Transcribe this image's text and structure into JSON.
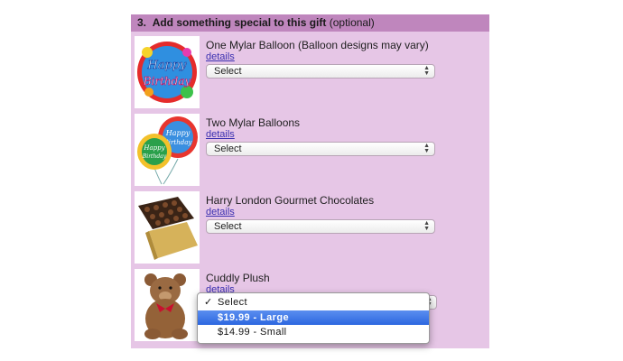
{
  "section": {
    "number": "3.",
    "title": "Add something special to this gift",
    "note": "(optional)"
  },
  "items": [
    {
      "title": "One Mylar Balloon (Balloon designs may vary)",
      "details": "details",
      "select_value": "Select",
      "image": "happy-birthday-balloon"
    },
    {
      "title": "Two Mylar Balloons",
      "details": "details",
      "select_value": "Select",
      "image": "two-birthday-balloons"
    },
    {
      "title": "Harry London Gourmet Chocolates",
      "details": "details",
      "select_value": "Select",
      "image": "chocolate-box"
    },
    {
      "title": "Cuddly Plush",
      "details": "details",
      "select_value": "Select",
      "image": "teddy-bear"
    }
  ],
  "dropdown": {
    "options": [
      "Select",
      "$19.99 - Large",
      "$14.99 - Small"
    ],
    "checked_index": 0,
    "highlighted_index": 1
  },
  "colors": {
    "panel_bg": "#e6c6e6",
    "header_bg": "#bf86bd",
    "link": "#3a2fb0",
    "highlight": "#2d67e0"
  }
}
